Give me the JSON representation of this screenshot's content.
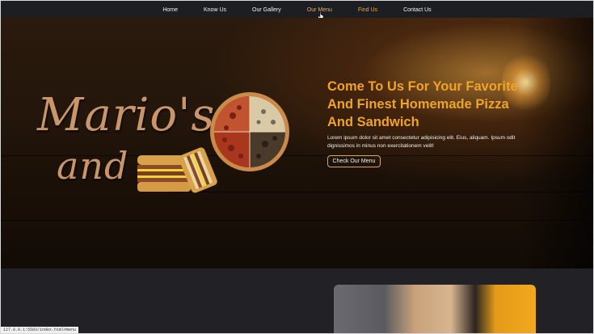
{
  "nav": {
    "items": [
      {
        "label": "Home"
      },
      {
        "label": "Know Us"
      },
      {
        "label": "Our Gallery"
      },
      {
        "label": "Our Menu"
      },
      {
        "label": "Find Us"
      },
      {
        "label": "Contact Us"
      }
    ]
  },
  "hero": {
    "logo_line1": "Mario's",
    "logo_line2": "and",
    "headline": "Come To Us For Your Favorite And Finest Homemade Pizza And Sandwich",
    "description": "Lorem ipsum dolor sit amet consectetur adipisicing elit. Eius, aliquam. Ipsum odit dignissimos in minus non exercitationem velit!",
    "cta_label": "Check Our Menu"
  },
  "colors": {
    "accent_orange": "#f0a32a",
    "hover_nav": "#e2b07a",
    "cta_border": "#d7a469",
    "nav_bg": "#1d1e22",
    "section_bg": "#212126"
  },
  "status_bar": {
    "url": "127.0.0.1:5503/index.html#menu"
  }
}
